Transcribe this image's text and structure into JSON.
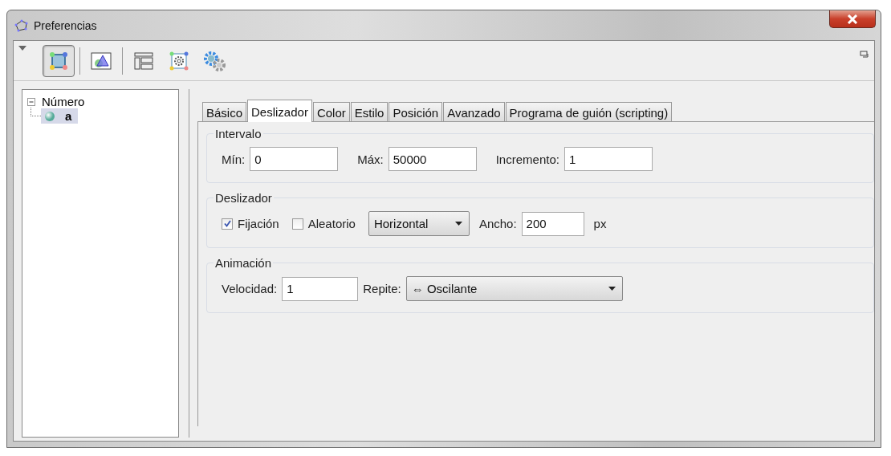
{
  "window": {
    "title": "Preferencias"
  },
  "toolbar": {
    "items": [
      {
        "kind": "points",
        "selected": true
      },
      {
        "kind": "graphics",
        "selected": false
      },
      {
        "kind": "layout",
        "selected": false
      },
      {
        "kind": "gearframe",
        "selected": false
      },
      {
        "kind": "gears",
        "selected": false
      }
    ]
  },
  "tree": {
    "items": [
      {
        "label": "Número",
        "expanded": true,
        "children": [
          {
            "label": "a",
            "selected": true
          }
        ]
      }
    ]
  },
  "tabs": [
    {
      "label": "Básico",
      "selected": false
    },
    {
      "label": "Deslizador",
      "selected": true
    },
    {
      "label": "Color",
      "selected": false
    },
    {
      "label": "Estilo",
      "selected": false
    },
    {
      "label": "Posición",
      "selected": false
    },
    {
      "label": "Avanzado",
      "selected": false
    },
    {
      "label": "Programa de guión (scripting)",
      "selected": false
    }
  ],
  "intervalo": {
    "title": "Intervalo",
    "fields": [
      {
        "label": "Mín:",
        "value": "0"
      },
      {
        "label": "Máx:",
        "value": "50000"
      },
      {
        "label": "Incremento:",
        "value": "1"
      }
    ]
  },
  "deslizador": {
    "title": "Deslizador",
    "checkboxes": [
      {
        "label": "Fijación",
        "checked": true
      },
      {
        "label": "Aleatorio",
        "checked": false
      }
    ],
    "orientation": "Horizontal",
    "width_label": "Ancho:",
    "width_value": "200",
    "unit": "px"
  },
  "animacion": {
    "title": "Animación",
    "speed_label": "Velocidad:",
    "speed_value": "1",
    "repeat_label": "Repite:",
    "repeat_value": "⇔ Oscilante"
  }
}
